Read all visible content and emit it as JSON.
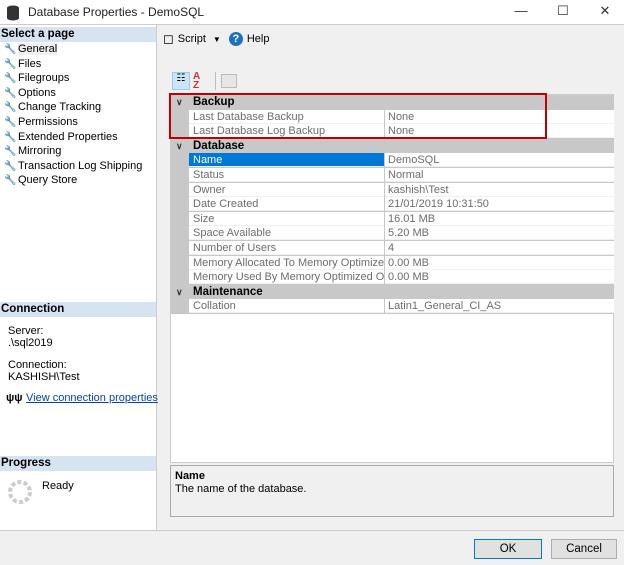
{
  "window": {
    "title": "Database Properties - DemoSQL",
    "controls": [
      "minimize",
      "maximize",
      "close"
    ]
  },
  "left": {
    "select_header": "Select a page",
    "pages": [
      {
        "label": "General",
        "selected": true
      },
      {
        "label": "Files"
      },
      {
        "label": "Filegroups"
      },
      {
        "label": "Options"
      },
      {
        "label": "Change Tracking"
      },
      {
        "label": "Permissions"
      },
      {
        "label": "Extended Properties"
      },
      {
        "label": "Mirroring"
      },
      {
        "label": "Transaction Log Shipping"
      },
      {
        "label": "Query Store"
      }
    ],
    "connection": {
      "header": "Connection",
      "server_label": "Server:",
      "server": ".\\sql2019",
      "connection_label": "Connection:",
      "connection": "KASHISH\\Test",
      "link": "View connection properties"
    },
    "progress": {
      "header": "Progress",
      "status": "Ready"
    }
  },
  "toolbar": {
    "script": "Script",
    "help": "Help"
  },
  "grid": {
    "categories": [
      {
        "name": "Backup",
        "props": [
          [
            "Last Database Backup",
            "None"
          ],
          [
            "Last Database Log Backup",
            "None"
          ]
        ]
      },
      {
        "name": "Database",
        "props": [
          [
            "Name",
            "DemoSQL"
          ],
          [
            "Status",
            "Normal"
          ],
          [
            "Owner",
            "kashish\\Test"
          ],
          [
            "Date Created",
            "21/01/2019 10:31:50"
          ],
          [
            "Size",
            "16.01 MB"
          ],
          [
            "Space Available",
            "5.20 MB"
          ],
          [
            "Number of Users",
            "4"
          ],
          [
            "Memory Allocated To Memory Optimized Objects",
            "0.00 MB"
          ],
          [
            "Memory Used By Memory Optimized Objects",
            "0.00 MB"
          ]
        ]
      },
      {
        "name": "Maintenance",
        "props": [
          [
            "Collation",
            "Latin1_General_CI_AS"
          ]
        ]
      }
    ],
    "selected": "Name",
    "highlight_color": "#c00000",
    "selection_color": "#0078d7"
  },
  "description": {
    "title": "Name",
    "text": "The name of the database."
  },
  "buttons": {
    "ok": "OK",
    "cancel": "Cancel"
  }
}
